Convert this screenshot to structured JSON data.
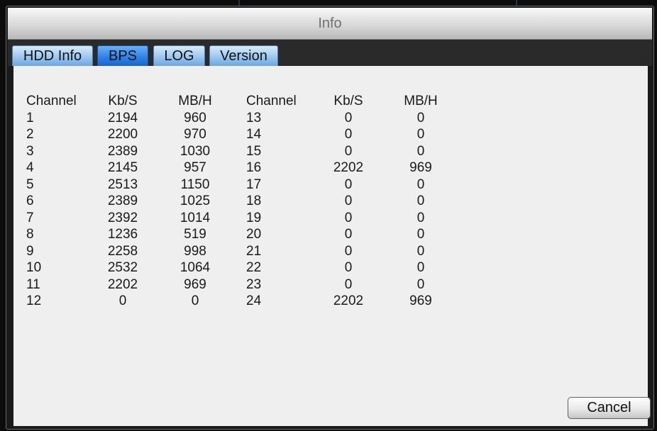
{
  "window": {
    "title": "Info"
  },
  "tabs": [
    {
      "label": "HDD Info",
      "active": false
    },
    {
      "label": "BPS",
      "active": true
    },
    {
      "label": "LOG",
      "active": false
    },
    {
      "label": "Version",
      "active": false
    }
  ],
  "table": {
    "headers": [
      "Channel",
      "Kb/S",
      "MB/H",
      "Channel",
      "Kb/S",
      "MB/H"
    ],
    "rows": [
      [
        "1",
        "2194",
        "960",
        "13",
        "0",
        "0"
      ],
      [
        "2",
        "2200",
        "970",
        "14",
        "0",
        "0"
      ],
      [
        "3",
        "2389",
        "1030",
        "15",
        "0",
        "0"
      ],
      [
        "4",
        "2145",
        "957",
        "16",
        "2202",
        "969"
      ],
      [
        "5",
        "2513",
        "1150",
        "17",
        "0",
        "0"
      ],
      [
        "6",
        "2389",
        "1025",
        "18",
        "0",
        "0"
      ],
      [
        "7",
        "2392",
        "1014",
        "19",
        "0",
        "0"
      ],
      [
        "8",
        "1236",
        "519",
        "20",
        "0",
        "0"
      ],
      [
        "9",
        "2258",
        "998",
        "21",
        "0",
        "0"
      ],
      [
        "10",
        "2532",
        "1064",
        "22",
        "0",
        "0"
      ],
      [
        "11",
        "2202",
        "969",
        "23",
        "0",
        "0"
      ],
      [
        "12",
        "0",
        "0",
        "24",
        "2202",
        "969"
      ]
    ]
  },
  "buttons": {
    "cancel_label": "Cancel"
  },
  "colors": {
    "tab_active": "#2f84e8",
    "tab_inactive": "#9cc8ef",
    "content_background": "#efefef",
    "window_frame": "#1a1a1a"
  }
}
